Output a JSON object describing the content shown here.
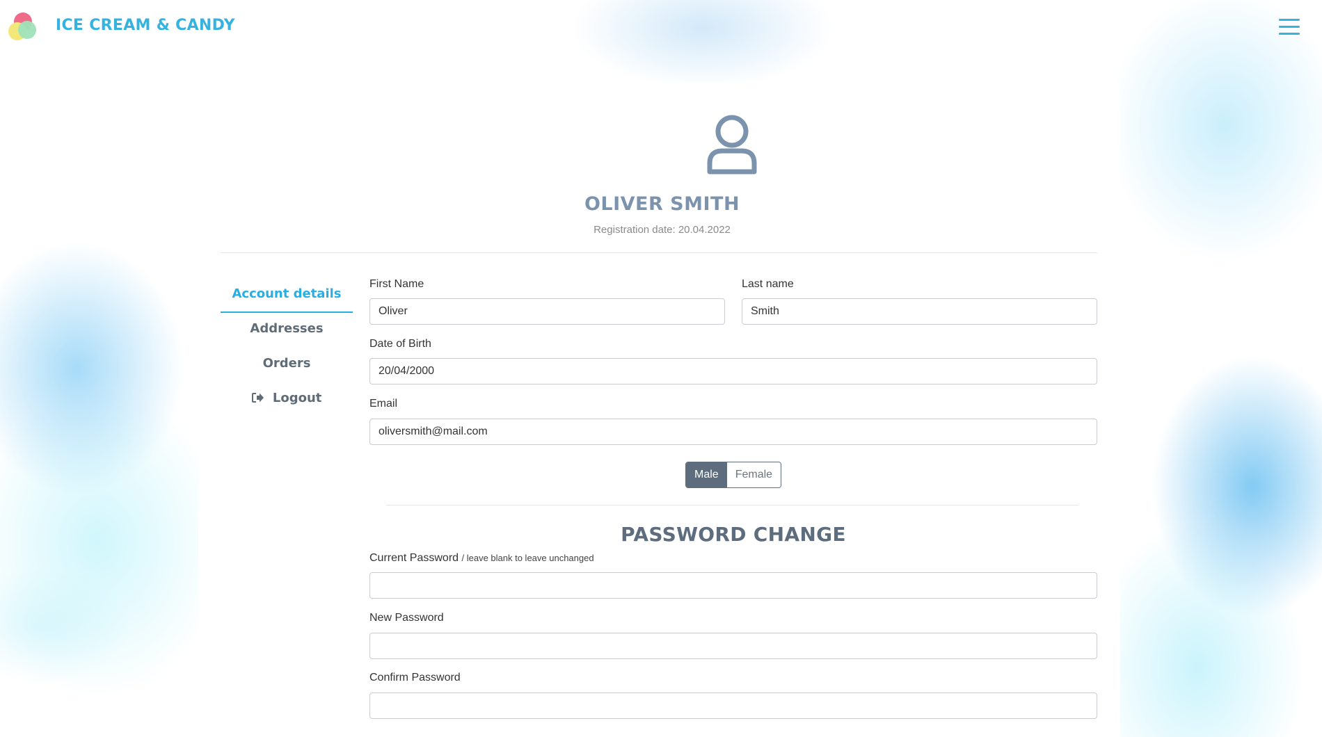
{
  "header": {
    "brand": "ICE CREAM & CANDY",
    "logo_colors": [
      "#f06a8a",
      "#f4e77a",
      "#9fe3b8"
    ],
    "menu_icon": "hamburger-menu-icon",
    "accent_color": "#35b3e0"
  },
  "profile": {
    "avatar_icon": "user-icon",
    "name": "OLIVER SMITH",
    "registration_date": "Registration date: 20.04.2022"
  },
  "sidebar": {
    "items": [
      {
        "label": "Account details",
        "active": true
      },
      {
        "label": "Addresses"
      },
      {
        "label": "Orders"
      },
      {
        "label": "Logout",
        "icon": "logout-icon"
      }
    ]
  },
  "form": {
    "first_name": {
      "label": "First Name",
      "value": "Oliver"
    },
    "last_name": {
      "label": "Last name",
      "value": "Smith"
    },
    "dob": {
      "label": "Date of Birth",
      "value": "20/04/2000"
    },
    "email": {
      "label": "Email",
      "value": "oliversmith@mail.com"
    },
    "gender": {
      "options": [
        "Male",
        "Female"
      ],
      "selected": "Male"
    }
  },
  "password": {
    "title": "PASSWORD CHANGE",
    "current": {
      "label": "Current Password",
      "hint": "/ leave blank to leave unchanged",
      "value": ""
    },
    "new": {
      "label": "New Password",
      "value": ""
    },
    "confirm": {
      "label": "Confirm Password",
      "value": ""
    }
  }
}
